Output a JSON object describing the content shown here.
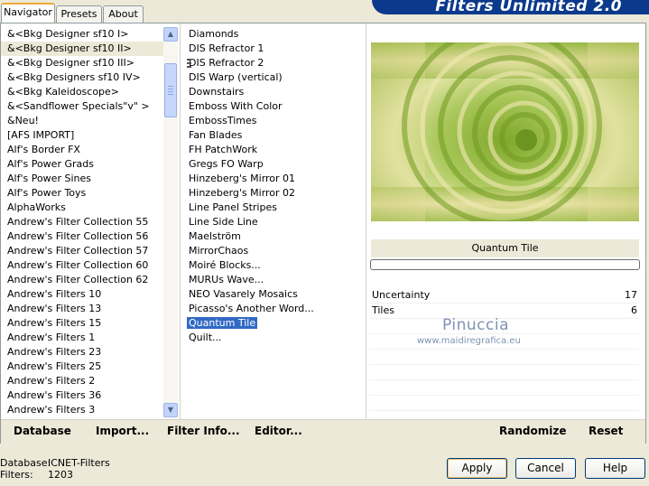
{
  "tabs": [
    "Navigator",
    "Presets",
    "About"
  ],
  "banner_title": "Filters Unlimited 2.0",
  "categories": [
    "&<Bkg Designer sf10 I>",
    "&<Bkg Designer sf10 II>",
    "&<Bkg Designer sf10 III>",
    "&<Bkg Designers sf10 IV>",
    "&<Bkg Kaleidoscope>",
    "&<Sandflower Specials\"v\" >",
    "&Neu!",
    "[AFS IMPORT]",
    "Alf's Border FX",
    "Alf's Power Grads",
    "Alf's Power Sines",
    "Alf's Power Toys",
    "AlphaWorks",
    "Andrew's Filter Collection 55",
    "Andrew's Filter Collection 56",
    "Andrew's Filter Collection 57",
    "Andrew's Filter Collection 60",
    "Andrew's Filter Collection 62",
    "Andrew's Filters 10",
    "Andrew's Filters 13",
    "Andrew's Filters 15",
    "Andrew's Filters 1",
    "Andrew's Filters 23",
    "Andrew's Filters 25",
    "Andrew's Filters 2",
    "Andrew's Filters 36",
    "Andrew's Filters 3"
  ],
  "filters": [
    "Diamonds",
    "DIS Refractor 1",
    "DIS Refractor 2",
    "DIS Warp (vertical)",
    "Downstairs",
    "Emboss With Color",
    "EmbossTimes",
    "Fan Blades",
    "FH PatchWork",
    "Gregs FO Warp",
    "Hinzeberg's Mirror 01",
    "Hinzeberg's Mirror 02",
    "Line Panel Stripes",
    "Line Side Line",
    "Maelström",
    "MirrorChaos",
    "Moiré Blocks...",
    "MURUs Wave...",
    "NEO Vasarely Mosaics",
    "Picasso's Another Word...",
    "Quantum Tile",
    "Quilt..."
  ],
  "selected_filter_name": "Quantum Tile",
  "params": [
    {
      "label": "Uncertainty",
      "value": "17"
    },
    {
      "label": "Tiles",
      "value": "6"
    }
  ],
  "toolbar": {
    "database": "Database",
    "import": "Import...",
    "filter_info": "Filter Info...",
    "editor": "Editor...",
    "randomize": "Randomize",
    "reset": "Reset"
  },
  "watermark": {
    "name": "Pinuccia",
    "url": "www.maidiregrafica.eu"
  },
  "footer": {
    "database_label": "Database:",
    "database_value": "ICNET-Filters",
    "filters_label": "Filters:",
    "filters_value": "1203"
  },
  "buttons": {
    "apply": "Apply",
    "cancel": "Cancel",
    "help": "Help"
  },
  "colors": {
    "selection": "#316ac5",
    "banner": "#0b3a8c",
    "preview_green": "#8fb33a",
    "preview_cream": "#efe0a6"
  }
}
